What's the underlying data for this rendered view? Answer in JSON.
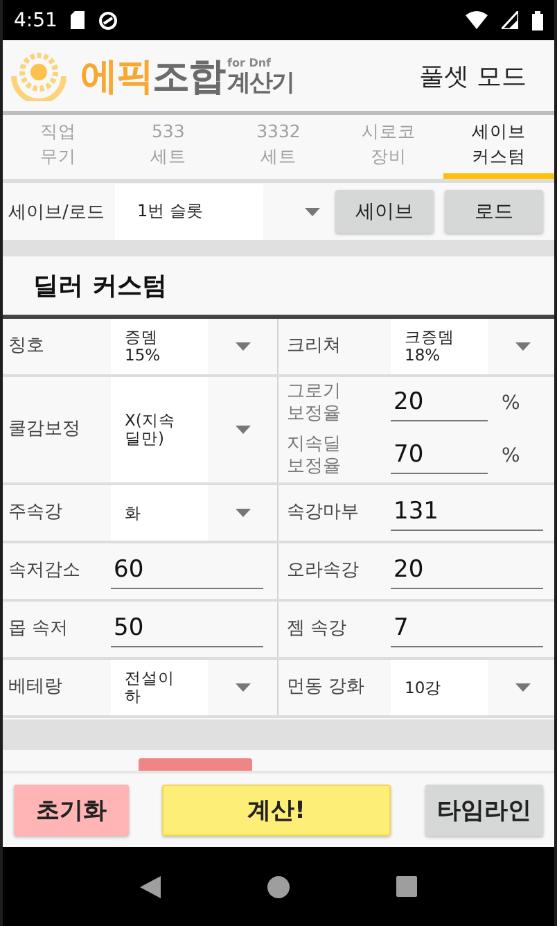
{
  "status_bar": {
    "time": "4:51"
  },
  "header": {
    "logo": [
      {
        "text": "에픽",
        "kind": "accent"
      },
      {
        "text": "조합",
        "kind": "main"
      },
      {
        "text": "for Dnf",
        "kind": "sup"
      },
      {
        "text": "계산기",
        "kind": "tail"
      }
    ],
    "mode": "풀셋 모드"
  },
  "tabs": [
    {
      "lines": [
        "직업",
        "무기"
      ],
      "selected": false
    },
    {
      "lines": [
        "533",
        "세트"
      ],
      "selected": false
    },
    {
      "lines": [
        "3332",
        "세트"
      ],
      "selected": false
    },
    {
      "lines": [
        "시로코",
        "장비"
      ],
      "selected": false
    },
    {
      "lines": [
        "세이브",
        "커스텀"
      ],
      "selected": true
    }
  ],
  "save_load": {
    "label": "세이브/로드",
    "slot": "1번 슬롯",
    "buttons": [
      "세이브",
      "로드"
    ]
  },
  "section_title": "딜러 커스텀",
  "rows": [
    {
      "cells": [
        {
          "kind": "select",
          "label": [
            "칭호"
          ],
          "value": [
            "증뎀",
            "15%"
          ]
        },
        {
          "kind": "select",
          "label": [
            "크리쳐"
          ],
          "value": [
            "크증뎀",
            "18%"
          ]
        }
      ]
    },
    {
      "cells": [
        {
          "kind": "select",
          "label": [
            "쿨감보정"
          ],
          "value": [
            "X(지속",
            "딜만)"
          ]
        },
        {
          "kind": "pair",
          "items": [
            {
              "label": [
                "그로기",
                "보정율"
              ],
              "value": "20",
              "suffix": "%"
            },
            {
              "label": [
                "지속딜",
                "보정율"
              ],
              "value": "70",
              "suffix": "%"
            }
          ]
        }
      ]
    },
    {
      "cells": [
        {
          "kind": "select",
          "label": [
            "주속강"
          ],
          "value": [
            "화"
          ]
        },
        {
          "kind": "input",
          "label": [
            "속강마부"
          ],
          "value": "131"
        }
      ]
    },
    {
      "cells": [
        {
          "kind": "input",
          "label": [
            "속저감소"
          ],
          "value": "60"
        },
        {
          "kind": "input",
          "label": [
            "오라속강"
          ],
          "value": "20"
        }
      ]
    },
    {
      "cells": [
        {
          "kind": "input",
          "label": [
            "몹 속저"
          ],
          "value": "50"
        },
        {
          "kind": "input",
          "label": [
            "젬 속강"
          ],
          "value": "7"
        }
      ]
    },
    {
      "cells": [
        {
          "kind": "select",
          "label": [
            "베테랑"
          ],
          "value": [
            "전설이",
            "하"
          ]
        },
        {
          "kind": "select",
          "label": [
            "먼동 강화"
          ],
          "value": [
            "10강"
          ]
        }
      ]
    }
  ],
  "footer_buttons": [
    {
      "label": "초기화",
      "kind": "reset"
    },
    {
      "label": "계산!",
      "kind": "calculate"
    },
    {
      "label": "타임라인",
      "kind": "neutral"
    }
  ]
}
